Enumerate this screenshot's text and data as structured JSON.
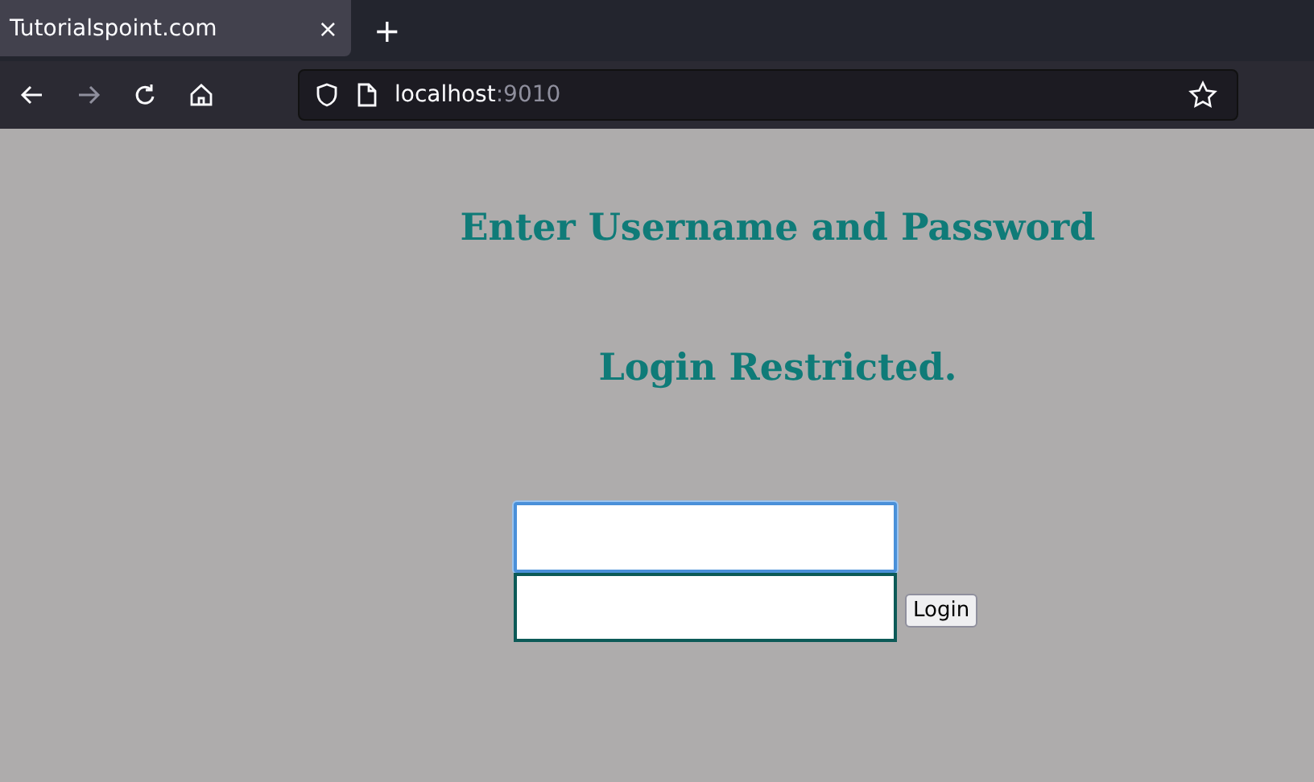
{
  "browser": {
    "tab": {
      "title": "Tutorialspoint.com",
      "close": "×"
    },
    "new_tab": "+",
    "address": {
      "host": "localhost",
      "port": ":9010"
    }
  },
  "page": {
    "headings": [
      "Enter Username and Password",
      "Login Restricted."
    ],
    "fields": [
      {
        "focused": true
      },
      {
        "focused": false
      }
    ],
    "button": "Login"
  }
}
